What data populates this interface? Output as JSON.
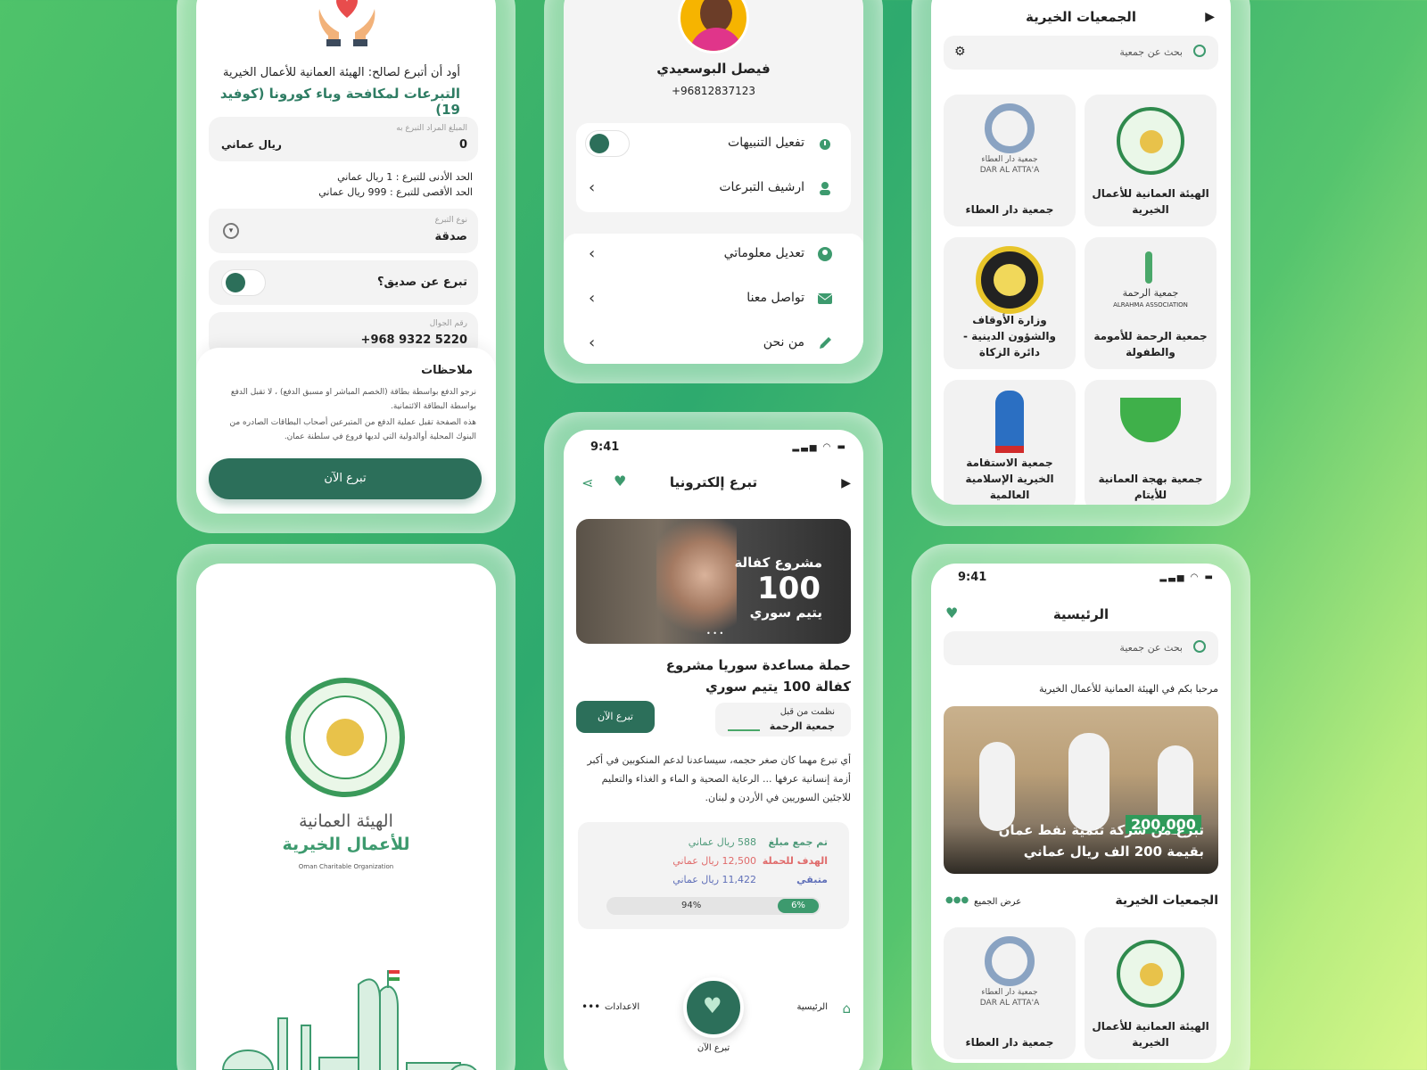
{
  "screens": {
    "donate_form": {
      "header_line": "أود أن أتبرع لصالح: الهيئة العمانية للأعمال الخيرية",
      "campaign_title": "التبرعات لمكافحة وباء كورونا (كوفيد 19)",
      "amount_label": "المبلغ المراد التبرع به",
      "amount_value": "0",
      "currency": "ريال عماني",
      "min_note": "الحد الأدنى للتبرع : 1 ريال عماني",
      "max_note": "الحد الأقصى للتبرع : 999 ريال عماني",
      "type_label": "نوع التبرع",
      "type_value": "صدقة",
      "friend_label": "تبرع عن صديق؟",
      "phone_label": "رقم الجوال",
      "phone_value": "+968 9322 5220",
      "notes_title": "ملاحظات",
      "note_1": "نرجو الدفع بواسطة بطاقة (الخصم المباشر او مسبق الدفع) ، لا تقبل الدفع بواسطة البطاقة الائتمانية.",
      "note_2": "هذه الصفحة تقبل عملية الدفع من المتبرعين أصحاب البطاقات الصادره من البنوك المحلية أوالدولية التي لديها فروع في سلطنة عمان.",
      "donate_button": "تبرع الآن"
    },
    "profile": {
      "name": "فيصل البوسعيدي",
      "phone": "+96812837123",
      "menu": [
        {
          "label": "تفعيل التنبيهات",
          "icon": "alarm-icon"
        },
        {
          "label": "ارشيف التبرعات",
          "icon": "archive-user-icon"
        },
        {
          "label": "تعديل معلوماتي",
          "icon": "user-icon"
        },
        {
          "label": "تواصل معنا",
          "icon": "mail-icon"
        },
        {
          "label": "من نحن",
          "icon": "pencil-icon"
        }
      ]
    },
    "charities": {
      "title": "الجمعيات الخيرية",
      "search_placeholder": "بحث عن جمعية",
      "orgs": [
        {
          "name": "الهيئة العمانية للأعمال الخيرية"
        },
        {
          "name": "جمعية دار العطاء",
          "logo_text": "جمعية دار العطاء",
          "logo_sub": "DAR AL ATTA'A"
        },
        {
          "name": "جمعية الرحمة للأمومة والطفولة",
          "logo_text": "جمعية الرحمة",
          "logo_sub": "ALRAHMA ASSOCIATION"
        },
        {
          "name": "وزارة الأوقاف والشؤون الدينية - دائرة الزكاة"
        },
        {
          "name": "جمعية بهجة العمانية للأيتام"
        },
        {
          "name": "جمعية الاستقامة الخيرية الإسلامية العالمية"
        }
      ]
    },
    "splash": {
      "title_line1": "الهيئة العمانية",
      "title_line2": "للأعمال الخيرية",
      "subtitle": "Oman Charitable Organization"
    },
    "campaign": {
      "time": "9:41",
      "title": "تبرع إلكترونيا",
      "banner_line1": "مشروع كفالة",
      "banner_number": "100",
      "banner_line2": "يتيم سوري",
      "campaign_title": "حملة مساعدة سوريا مشروع كفالة 100 يتيم سوري",
      "organized_by_label": "نظمت من قبل",
      "organizer": "جمعية الرحمة",
      "donate_button": "تبرع الآن",
      "description": "أي تبرع مهما كان صغر حجمه، سيساعدنا لدعم المنكوبين في أكبر أزمة إنسانية عرفها ... الرعاية الصحية و الماء و الغذاء والتعليم للاجئين السوريين في الأردن و لبنان.",
      "stats": [
        {
          "label": "تم جمع مبلغ",
          "value": "588 ريال عماني",
          "color": "#4f9a7a"
        },
        {
          "label": "الهدف للحملة",
          "value": "12,500 ريال عماني",
          "color": "#e06b6b"
        },
        {
          "label": "متبقي",
          "value": "11,422 ريال عماني",
          "color": "#5f6fb8"
        }
      ],
      "progress_raised": 0.06,
      "progress_raised_label": "6%",
      "progress_remaining_label": "94%",
      "nav": {
        "home": "الرئيسية",
        "donate": "تبرع الآن",
        "settings": "الاعدادات"
      }
    },
    "home": {
      "time": "9:41",
      "title": "الرئيسية",
      "search_placeholder": "بحث عن جمعية",
      "welcome": "مرحبا بكم في الهيئة العمانية للأعمال الخيرية",
      "banner_amount": "200,000",
      "banner_line1": "تبرع من شركة تنمية نفط عمان",
      "banner_line2": "بقيمة 200 الف ريال عماني",
      "section_title": "الجمعيات الخيرية",
      "view_all": "عرض الجميع",
      "orgs": [
        {
          "name": "الهيئة العمانية للأعمال الخيرية"
        },
        {
          "name": "جمعية دار العطاء",
          "logo_text": "جمعية دار العطاء",
          "logo_sub": "DAR AL ATTA'A"
        }
      ]
    }
  },
  "colors": {
    "primary": "#2c6f5a",
    "accent": "#3d9a6e",
    "bg_start": "#4fc36a",
    "bg_end": "#d8f78a"
  }
}
